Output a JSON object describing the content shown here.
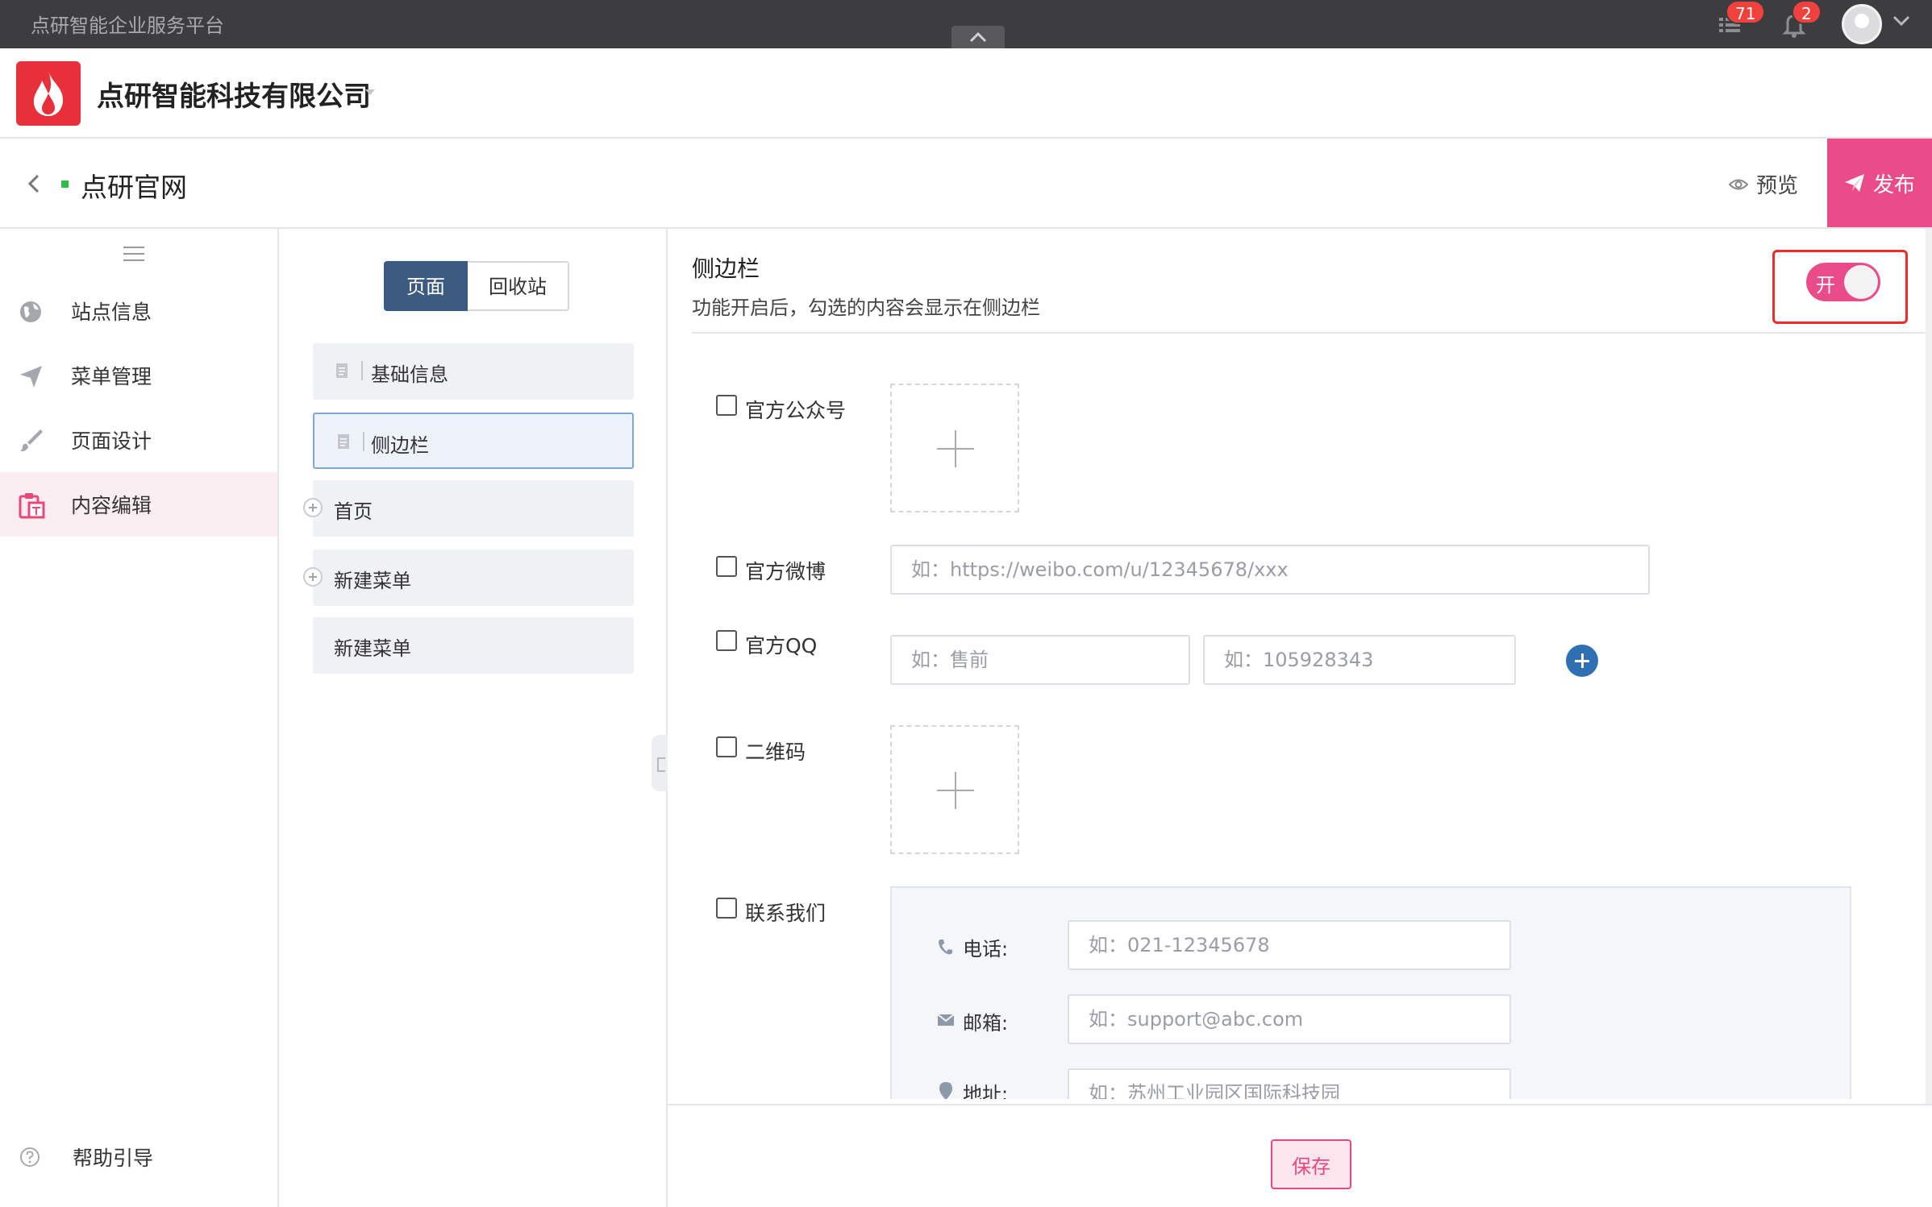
{
  "topbar": {
    "platform_name": "点研智能企业服务平台",
    "tasks_badge": "71",
    "notifications_badge": "2"
  },
  "header": {
    "company_name": "点研智能科技有限公司"
  },
  "titlebar": {
    "site_name": "点研官网",
    "preview_label": "预览",
    "publish_label": "发布"
  },
  "nav": {
    "items": [
      {
        "label": "站点信息",
        "icon": "globe-icon"
      },
      {
        "label": "菜单管理",
        "icon": "send-icon"
      },
      {
        "label": "页面设计",
        "icon": "brush-icon"
      },
      {
        "label": "内容编辑",
        "icon": "clipboard-icon",
        "active": true
      }
    ],
    "help_label": "帮助引导"
  },
  "pages_panel": {
    "tabs": [
      "页面",
      "回收站"
    ],
    "items": [
      "基础信息",
      "侧边栏",
      "首页",
      "新建菜单",
      "新建菜单"
    ]
  },
  "content": {
    "section_title": "侧边栏",
    "section_desc": "功能开启后，勾选的内容会显示在侧边栏",
    "toggle_label": "开",
    "options": {
      "wechat_label": "官方公众号",
      "weibo_label": "官方微博",
      "weibo_placeholder": "如：https://weibo.com/u/12345678/xxx",
      "qq_label": "官方QQ",
      "qq_name_placeholder": "如：售前",
      "qq_number_placeholder": "如：105928343",
      "qrcode_label": "二维码",
      "contact_label": "联系我们"
    },
    "contact": {
      "phone_label": "电话:",
      "phone_placeholder": "如：021-12345678",
      "email_label": "邮箱:",
      "email_placeholder": "如：support@abc.com",
      "address_label": "地址:",
      "address_placeholder": "如：苏州工业园区国际科技园"
    },
    "save_label": "保存"
  },
  "colors": {
    "accent": "#ea4c89",
    "nav_active_bg": "#fbeef2",
    "segment_active": "#3d5a80",
    "highlight_box": "#f02a2a"
  }
}
